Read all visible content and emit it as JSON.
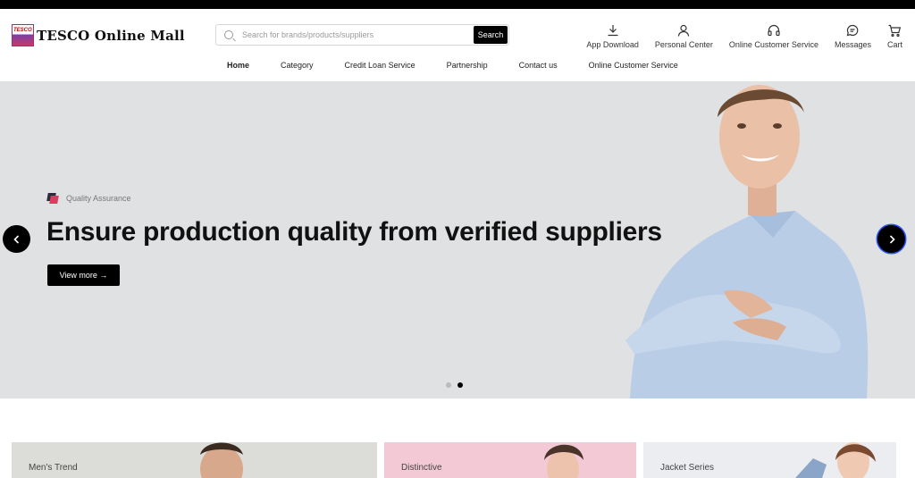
{
  "brand": {
    "logo_badge": "TESCO",
    "name": "TESCO Online Mall"
  },
  "search": {
    "placeholder": "Search for brands/products/suppliers",
    "value": "",
    "button_label": "Search"
  },
  "header_actions": [
    {
      "label": "App Download",
      "icon": "download-icon"
    },
    {
      "label": "Personal Center",
      "icon": "user-icon"
    },
    {
      "label": "Online Customer Service",
      "icon": "headset-icon"
    },
    {
      "label": "Messages",
      "icon": "chat-icon"
    },
    {
      "label": "Cart",
      "icon": "cart-icon"
    }
  ],
  "nav": [
    {
      "label": "Home",
      "active": true
    },
    {
      "label": "Category"
    },
    {
      "label": "Credit Loan Service"
    },
    {
      "label": "Partnership"
    },
    {
      "label": "Contact us"
    },
    {
      "label": "Online Customer Service"
    }
  ],
  "hero": {
    "tag": "Quality Assurance",
    "title": "Ensure production quality from verified suppliers",
    "button_label": "View more →",
    "slides": 2,
    "active_slide": 2,
    "background": "#dfe1e3"
  },
  "cards": [
    {
      "label": "Men's Trend",
      "color": "#dcdcd8"
    },
    {
      "label": "Distinctive",
      "color": "#f3c9d6"
    },
    {
      "label": "Jacket Series",
      "color": "#ecedf0"
    }
  ]
}
